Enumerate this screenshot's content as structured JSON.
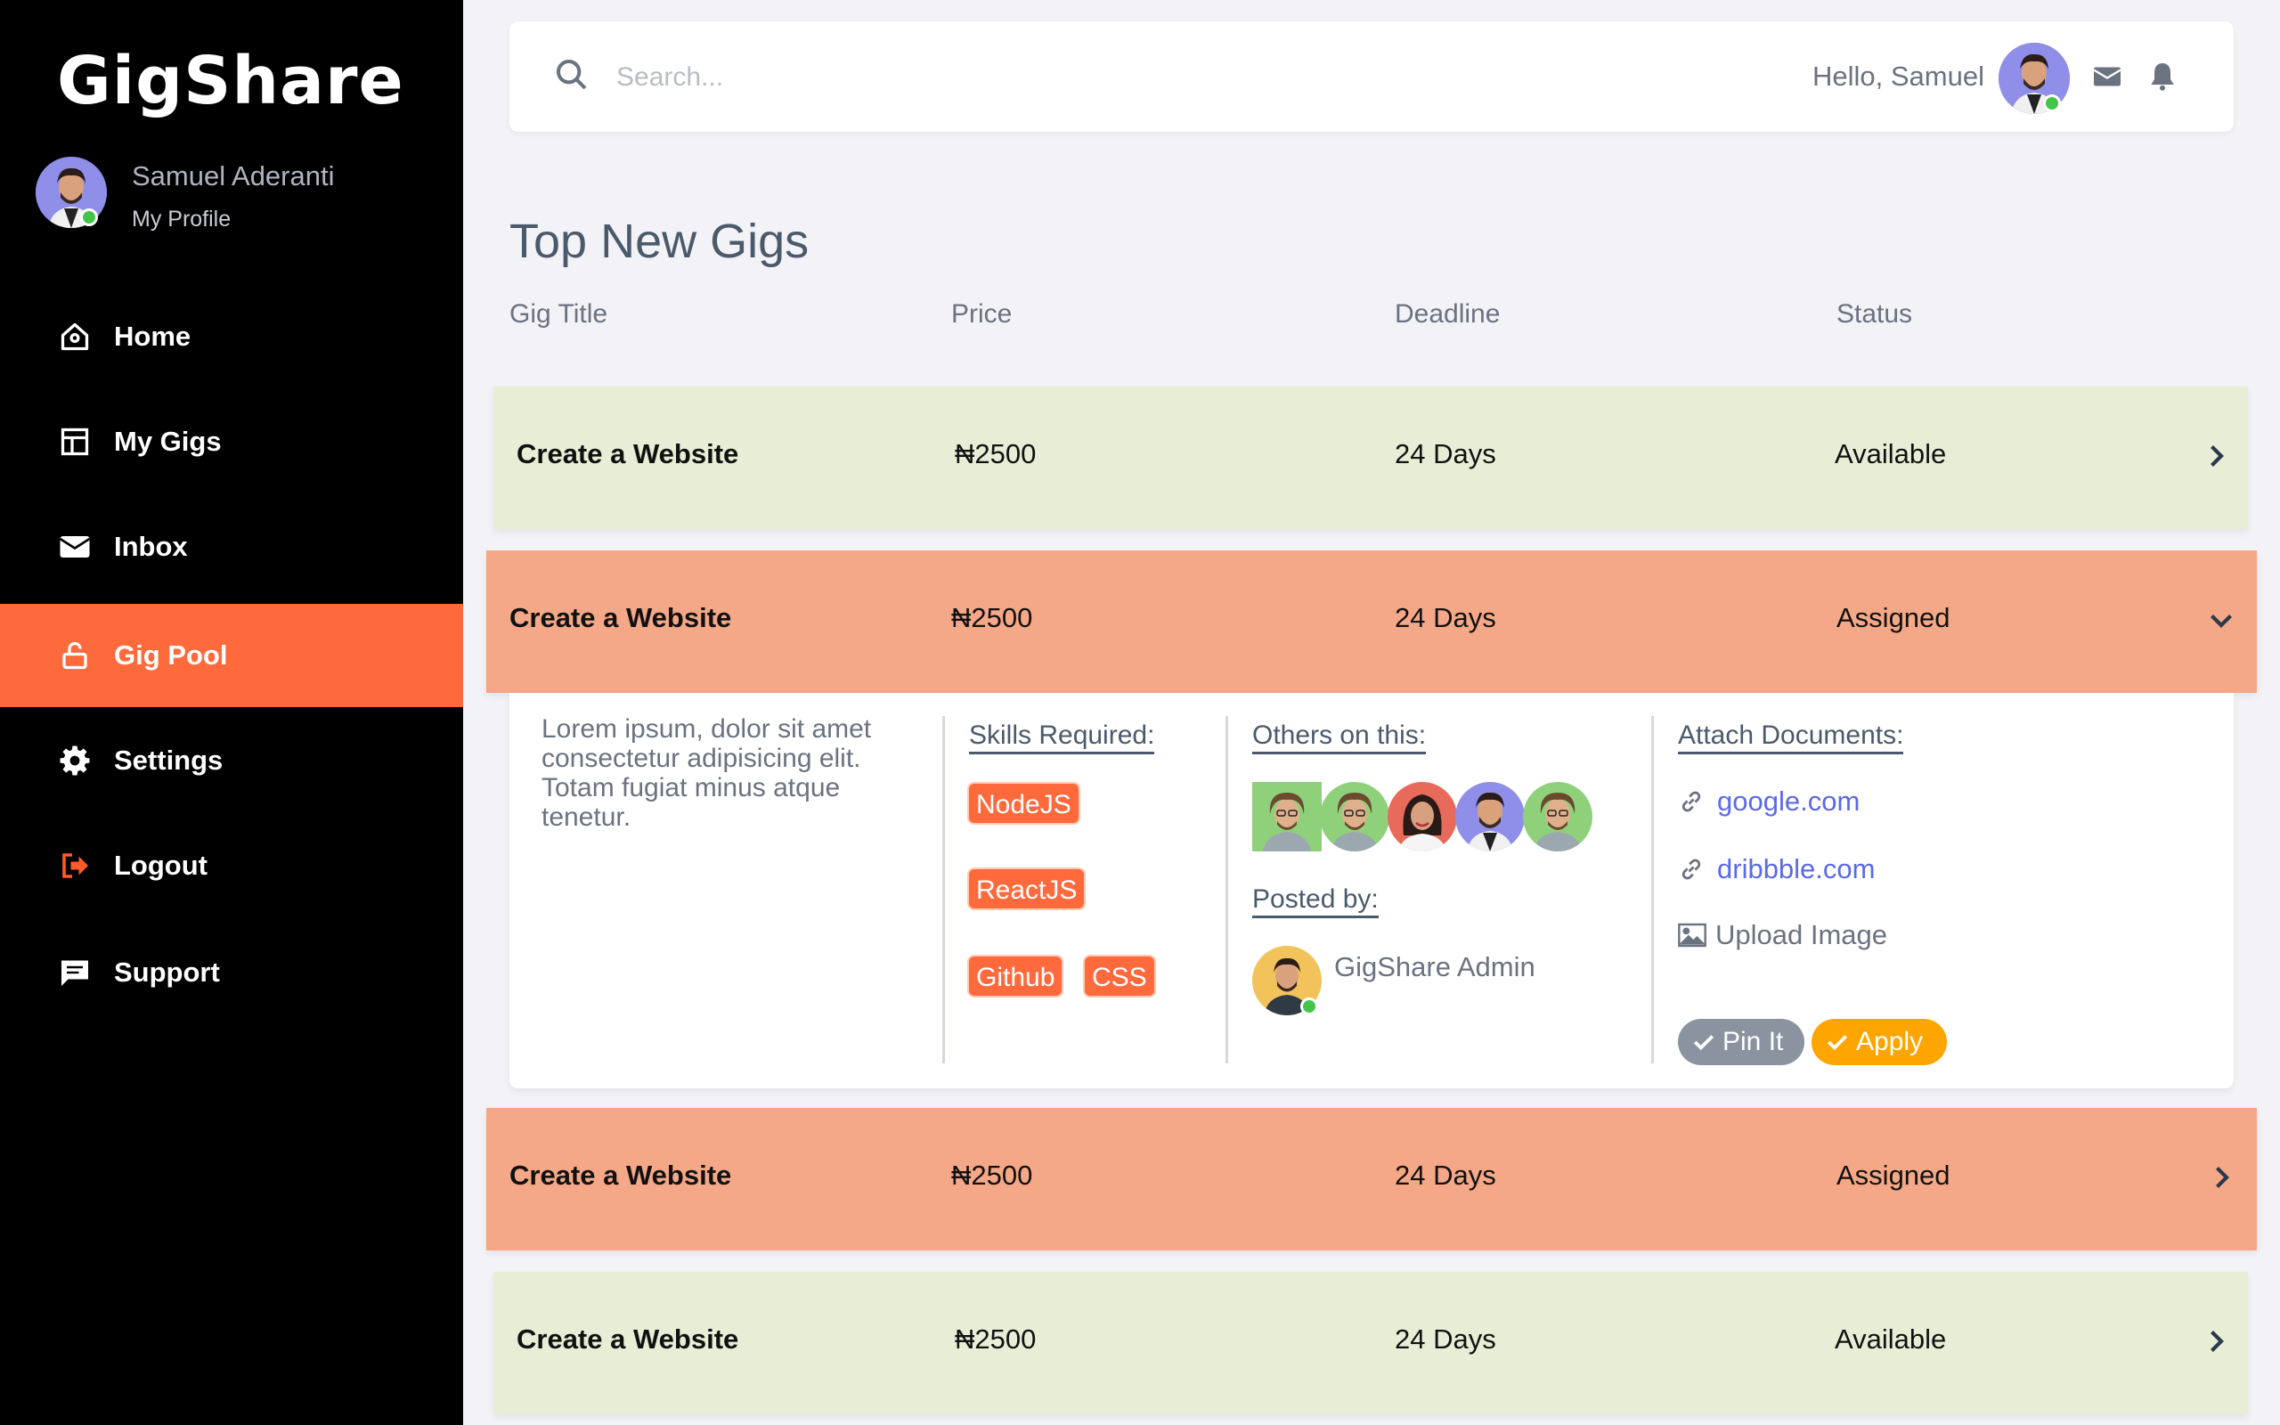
{
  "app": {
    "logo": "GigShare"
  },
  "user": {
    "name": "Samuel Aderanti",
    "profile_link": "My Profile",
    "greeting": "Hello, Samuel"
  },
  "sidebar": {
    "items": [
      {
        "label": "Home",
        "icon": "home-icon"
      },
      {
        "label": "My Gigs",
        "icon": "layout-icon"
      },
      {
        "label": "Inbox",
        "icon": "envelope-icon"
      },
      {
        "label": "Gig Pool",
        "icon": "lock-icon",
        "active": true
      },
      {
        "label": "Settings",
        "icon": "gear-icon"
      },
      {
        "label": "Logout",
        "icon": "logout-icon"
      },
      {
        "label": "Support",
        "icon": "chat-icon"
      }
    ]
  },
  "search": {
    "placeholder": "Search...",
    "value": ""
  },
  "main": {
    "title": "Top New Gigs",
    "columns": [
      "Gig Title",
      "Price",
      "Deadline",
      "Status"
    ],
    "gigs": [
      {
        "title": "Create a Website",
        "price": "₦2500",
        "deadline": "24 Days",
        "status": "Available",
        "expanded": false
      },
      {
        "title": "Create a Website",
        "price": "₦2500",
        "deadline": "24 Days",
        "status": "Assigned",
        "expanded": true
      },
      {
        "title": "Create a Website",
        "price": "₦2500",
        "deadline": "24 Days",
        "status": "Assigned",
        "expanded": false
      },
      {
        "title": "Create a Website",
        "price": "₦2500",
        "deadline": "24 Days",
        "status": "Available",
        "expanded": false
      }
    ]
  },
  "detail": {
    "description": "Lorem ipsum, dolor sit amet consectetur adipisicing elit. Totam fugiat minus atque tenetur.",
    "skills_heading": "Skills Required:",
    "skills": [
      "NodeJS",
      "ReactJS",
      "Github",
      "CSS"
    ],
    "others_heading": "Others on this:",
    "posted_heading": "Posted by:",
    "posted_by": "GigShare Admin",
    "attach_heading": "Attach Documents:",
    "links": [
      "google.com",
      "dribbble.com"
    ],
    "upload_label": "Upload Image",
    "pin_label": "Pin It",
    "apply_label": "Apply"
  },
  "colors": {
    "sidebar_bg": "#000000",
    "accent": "#ff6a3d",
    "available_row": "#e8eed6",
    "assigned_row": "#f5a887",
    "apply": "#ffa500",
    "pin": "#8a939f",
    "link": "#5b6ae6"
  }
}
